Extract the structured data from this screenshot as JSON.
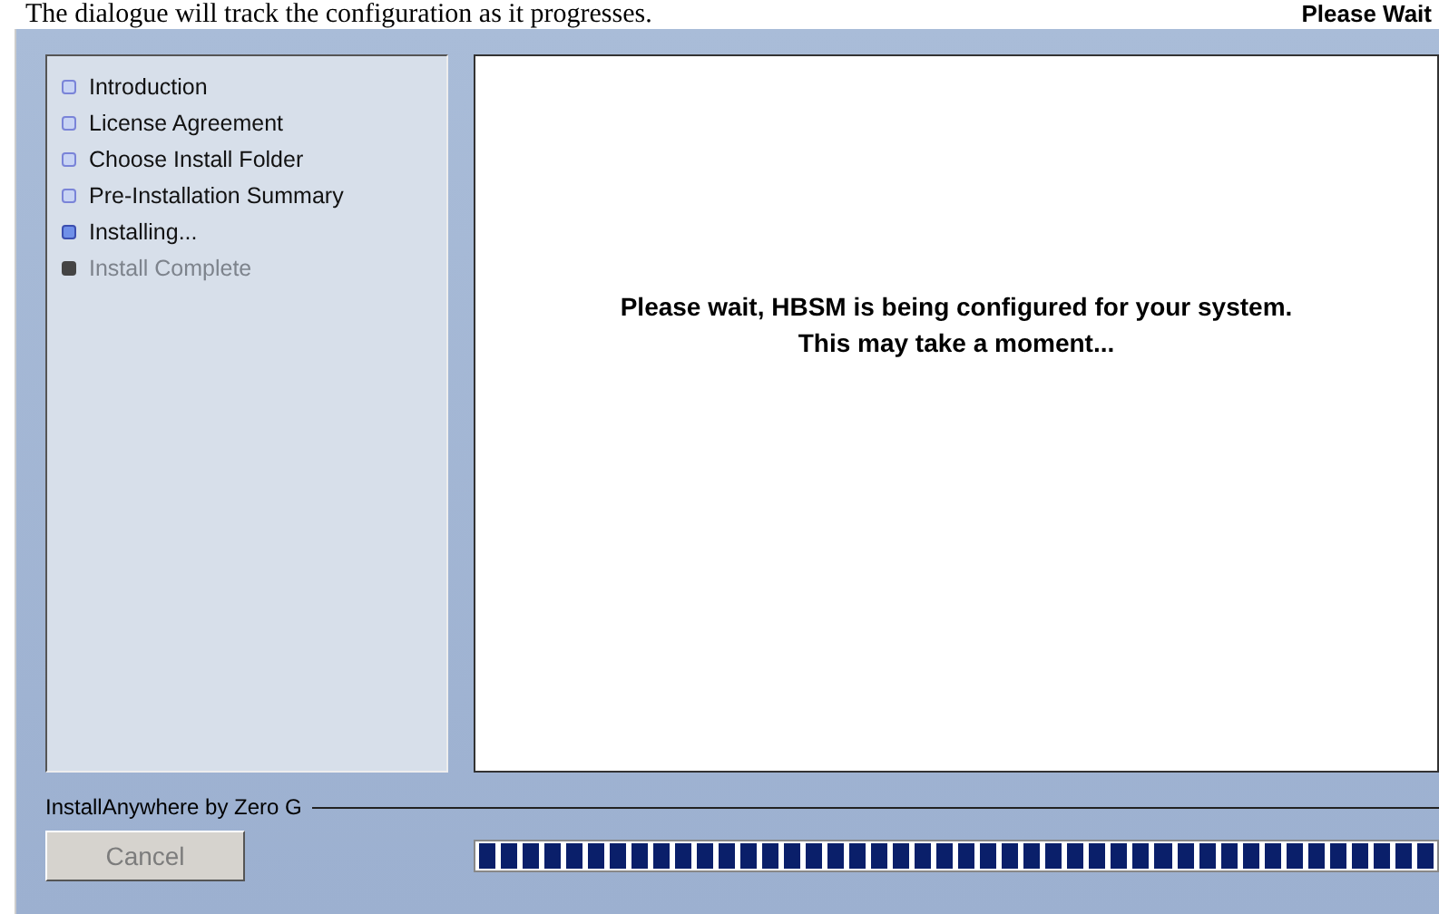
{
  "document_text": "The dialogue will track the configuration as it progresses.",
  "window": {
    "title": "Please Wait"
  },
  "steps": [
    {
      "label": "Introduction",
      "selected": false,
      "disabled": false
    },
    {
      "label": "License Agreement",
      "selected": false,
      "disabled": false
    },
    {
      "label": "Choose Install Folder",
      "selected": false,
      "disabled": false
    },
    {
      "label": "Pre-Installation Summary",
      "selected": false,
      "disabled": false
    },
    {
      "label": "Installing...",
      "selected": true,
      "disabled": false
    },
    {
      "label": "Install Complete",
      "selected": false,
      "disabled": true
    }
  ],
  "message": "Please wait,  HBSM is being configured for your system. This may take a moment...",
  "footer": {
    "label": "InstallAnywhere by Zero G"
  },
  "cancel_button": {
    "label": "Cancel",
    "disabled": true
  },
  "progress": {
    "level": 1
  }
}
